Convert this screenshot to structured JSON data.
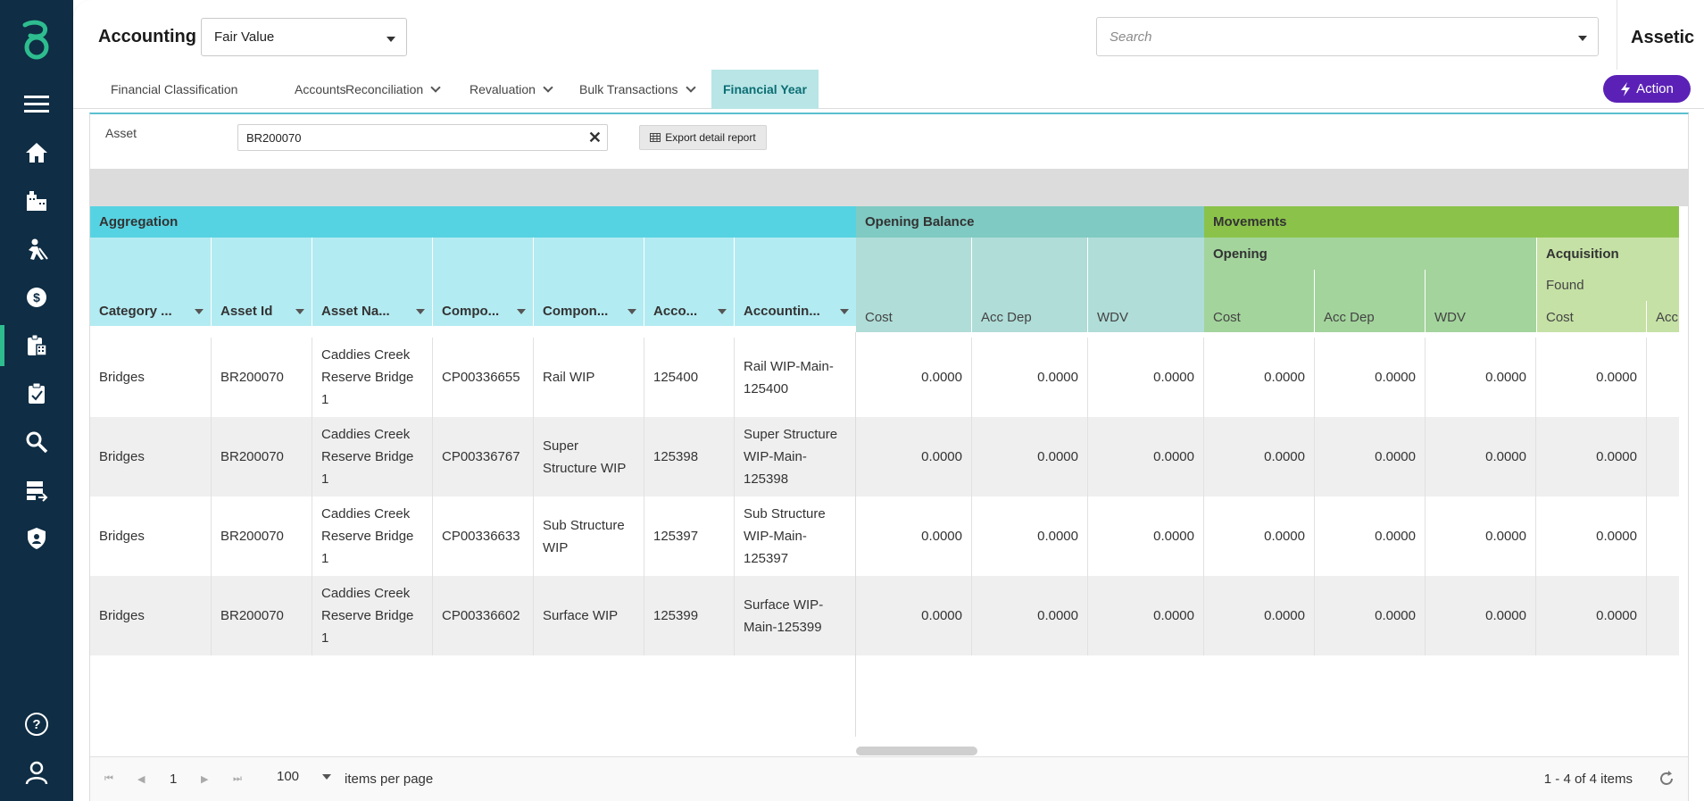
{
  "app": {
    "title": "Accounting",
    "context_select": "Fair Value",
    "search_placeholder": "Search",
    "brand": "Assetic"
  },
  "sidebar": {
    "icons": [
      "menu-icon",
      "home-icon",
      "buildings-icon",
      "worker-icon",
      "finance-icon",
      "accounting-icon",
      "assessment-icon",
      "search-icon",
      "data-transfer-icon",
      "security-icon",
      "help-icon",
      "user-icon"
    ]
  },
  "nav": {
    "items": [
      {
        "label": "Financial Classification",
        "dropdown": false
      },
      {
        "label": "Accounts",
        "dropdown": false
      },
      {
        "label": "Reconciliation",
        "dropdown": true
      },
      {
        "label": "Revaluation",
        "dropdown": true
      },
      {
        "label": "Bulk Transactions",
        "dropdown": true
      },
      {
        "label": "Financial Year",
        "dropdown": false
      }
    ],
    "action_label": "Action"
  },
  "filter": {
    "label": "Asset",
    "value": "BR200070",
    "export_label": "Export detail report"
  },
  "grid": {
    "groups": {
      "aggregation": "Aggregation",
      "opening_balance": "Opening Balance",
      "movements": "Movements",
      "opening": "Opening",
      "acquisition": "Acquisition",
      "found": "Found"
    },
    "columns": [
      "Category ...",
      "Asset Id",
      "Asset Na...",
      "Compo...",
      "Compon...",
      "Acco...",
      "Accountin...",
      "Cost",
      "Acc Dep",
      "WDV",
      "Cost",
      "Acc Dep",
      "WDV",
      "Cost",
      "Acc"
    ],
    "rows": [
      [
        "Bridges",
        "BR200070",
        "Caddies Creek Reserve Bridge 1",
        "CP00336655",
        "Rail WIP",
        "125400",
        "Rail WIP-Main-125400",
        "0.0000",
        "0.0000",
        "0.0000",
        "0.0000",
        "0.0000",
        "0.0000",
        "0.0000"
      ],
      [
        "Bridges",
        "BR200070",
        "Caddies Creek Reserve Bridge 1",
        "CP00336767",
        "Super Structure WIP",
        "125398",
        "Super Structure WIP-Main-125398",
        "0.0000",
        "0.0000",
        "0.0000",
        "0.0000",
        "0.0000",
        "0.0000",
        "0.0000"
      ],
      [
        "Bridges",
        "BR200070",
        "Caddies Creek Reserve Bridge 1",
        "CP00336633",
        "Sub Structure WIP",
        "125397",
        "Sub Structure WIP-Main-125397",
        "0.0000",
        "0.0000",
        "0.0000",
        "0.0000",
        "0.0000",
        "0.0000",
        "0.0000"
      ],
      [
        "Bridges",
        "BR200070",
        "Caddies Creek Reserve Bridge 1",
        "CP00336602",
        "Surface WIP",
        "125399",
        "Surface WIP-Main-125399",
        "0.0000",
        "0.0000",
        "0.0000",
        "0.0000",
        "0.0000",
        "0.0000",
        "0.0000"
      ]
    ]
  },
  "pager": {
    "page": "1",
    "page_size": "100",
    "page_size_label": "items per page",
    "info": "1 - 4 of 4 items"
  },
  "colors": {
    "rail": "#0f2d44",
    "accent": "#2ebd8f",
    "aggregation": "#56d3e2",
    "aggregation_leaf": "#b3ebf2",
    "opening_balance": "#7fcac3",
    "opening_balance_leaf": "#b0ddd8",
    "movements": "#8bc34a",
    "opening": "#a3d49c",
    "acquisition": "#c5e1a5",
    "action": "#5b21b6"
  }
}
